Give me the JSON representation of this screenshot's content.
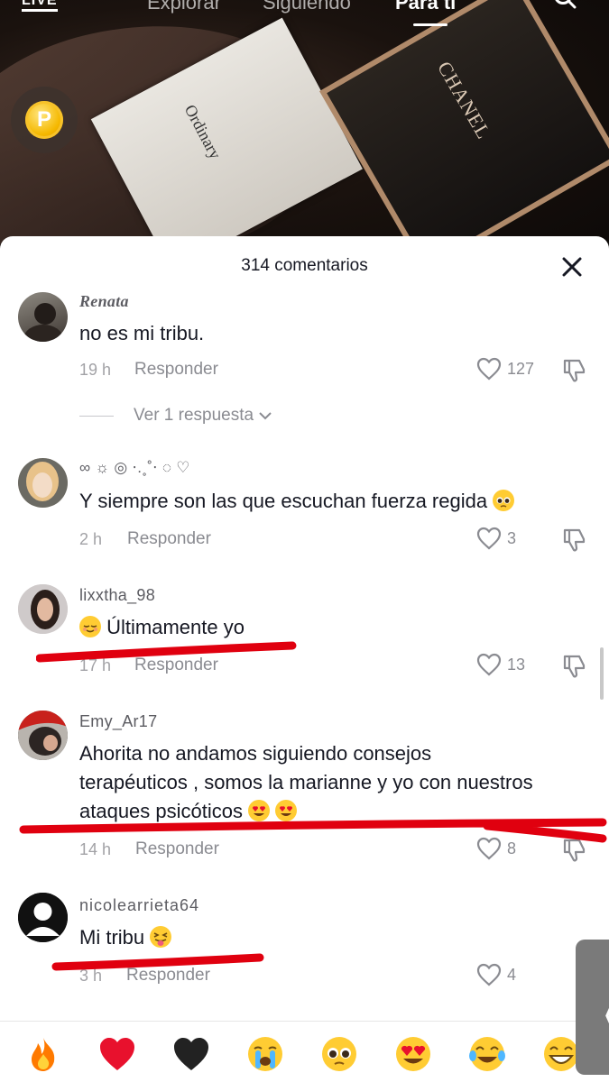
{
  "top_nav": {
    "live_label": "LIVE",
    "tabs": [
      {
        "label": "Explorar",
        "active": false
      },
      {
        "label": "Siguiendo",
        "active": false
      },
      {
        "label": "Para ti",
        "active": true
      }
    ]
  },
  "coin": {
    "symbol": "P"
  },
  "video": {
    "box_left_label": "Ordinary",
    "box_right_label": "CHANEL"
  },
  "sheet": {
    "title": "314 comentarios",
    "comments": [
      {
        "username": "Renata",
        "text": "no es mi tribu.",
        "time": "19 h",
        "reply_label": "Responder",
        "likes": "127",
        "view_replies": "Ver 1 respuesta"
      },
      {
        "username": "∞ ☼ ◎ ⋅.˳˚⋅ ◌ ♡",
        "text": "Y siempre son las que escuchan fuerza regida",
        "emoji": "pleading-face",
        "time": "2 h",
        "reply_label": "Responder",
        "likes": "3"
      },
      {
        "username": "lixxtha_98",
        "text": "Últimamente yo",
        "emoji": "relieved-face",
        "time": "17 h",
        "reply_label": "Responder",
        "likes": "13"
      },
      {
        "username": "Emy_Ar17",
        "text_lines": [
          "Ahorita no andamos siguiendo consejos",
          "terapéuticos , somos la marianne y yo con nuestros",
          "ataques psicóticos"
        ],
        "emoji": "heart-eyes",
        "time": "14 h",
        "reply_label": "Responder",
        "likes": "8"
      },
      {
        "username": "nicolearrieta64",
        "text": "Mi tribu",
        "emoji": "squinting-tongue",
        "time": "3 h",
        "reply_label": "Responder",
        "likes": "4"
      }
    ]
  },
  "emoji_bar": {
    "items": [
      "fire",
      "red-heart",
      "black-heart",
      "loudly-crying",
      "pleading-face",
      "heart-eyes",
      "tears-of-joy",
      "grinning-face"
    ]
  },
  "side_handle": {
    "glyph": "〈"
  },
  "colors": {
    "annotation_red": "#e0000f",
    "sheet_bg": "#ffffff",
    "secondary_text": "#8a8b91",
    "coin": "#f5b800"
  }
}
